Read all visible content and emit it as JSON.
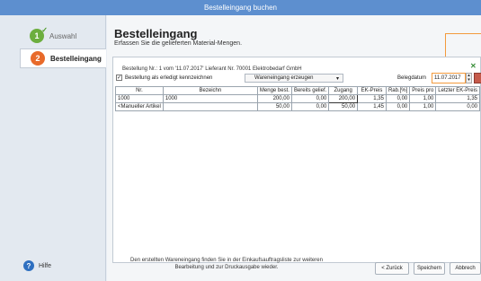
{
  "window": {
    "title": "Bestelleingang buchen"
  },
  "sidebar": {
    "steps": [
      {
        "number": "1",
        "label": "Auswahl",
        "state": "done"
      },
      {
        "number": "2",
        "label": "Bestelleingang",
        "state": "active"
      }
    ],
    "help_label": "Hilfe"
  },
  "header": {
    "title": "Bestelleingang",
    "subtitle": "Erfassen Sie die gelieferten Material-Mengen."
  },
  "order": {
    "info": "Bestellung Nr.: 1  vom '11.07.2017'  Lieferant Nr. 70001 Elektrobedarf GmbH",
    "checkbox_label": "Bestellung als erledigt kennzeichnen",
    "checkbox_checked": true,
    "dropdown_value": "Wareneingang erzeugen",
    "date_label": "Belegdatum",
    "date_value": "11.07.2017"
  },
  "table": {
    "columns": [
      "Nr.",
      "Bezeichn",
      "Menge best.",
      "Bereits gelief.",
      "Zugang",
      "EK-Preis",
      "Rab.[%]",
      "Preis pro",
      "Letzter EK-Preis"
    ],
    "rows": [
      [
        "1000",
        "1000",
        "200,00",
        "0,00",
        "200,00",
        "1,35",
        "0,00",
        "1,00",
        "1,35"
      ],
      [
        "<Manueller Artikel",
        "",
        "50,00",
        "0,00",
        "50,00",
        "1,45",
        "0,00",
        "1,00",
        "0,00"
      ]
    ]
  },
  "footer": {
    "note": "Den erstellten Wareneingang finden Sie in der Einkaufsauftragsliste zur weiteren Bearbeitung und zur Druckausgabe wieder.",
    "back_label": "< Zurück",
    "save_label": "Speichern",
    "cancel_label": "Abbrech"
  },
  "colors": {
    "titlebar": "#5d8fcf",
    "accent_orange": "#e86a2a",
    "done_green": "#6cae3e",
    "callout": "#f39a3c"
  }
}
